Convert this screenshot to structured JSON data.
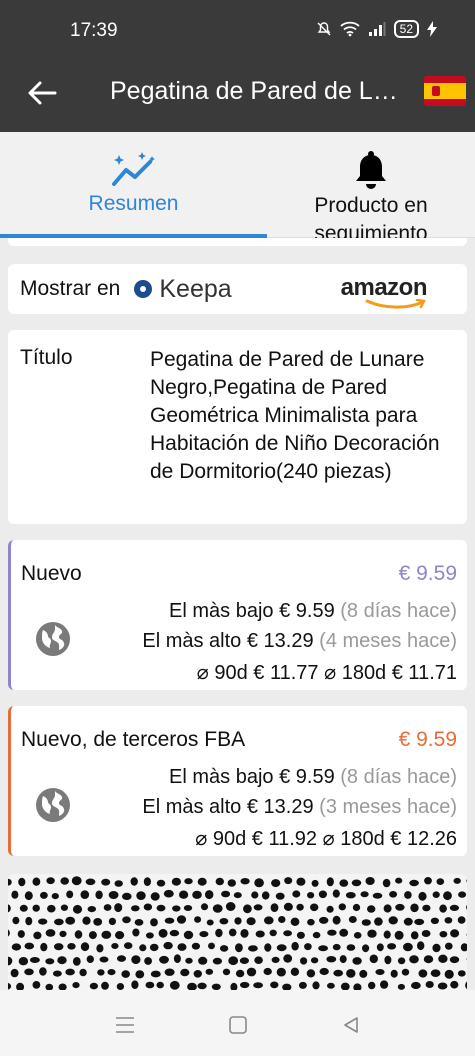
{
  "status_bar": {
    "time": "17:39",
    "battery": "52",
    "icons": [
      "mute-icon",
      "wifi-icon",
      "signal-icon",
      "battery-icon",
      "charging-icon"
    ]
  },
  "app_bar": {
    "title": "Pegatina de Pared de L…",
    "back_icon": "arrow-left-icon",
    "flag": "spain-flag"
  },
  "tabs": [
    {
      "label": "Resumen",
      "icon": "chart-sparkle-icon",
      "active": true
    },
    {
      "label": "Producto en seguimiento",
      "icon": "bell-icon",
      "active": false
    }
  ],
  "show_in": {
    "label": "Mostrar en",
    "keepa": "Keepa",
    "amazon": "amazon"
  },
  "title_section": {
    "label": "Título",
    "value": "Pegatina de Pared de Lunare Negro,Pegatina de Pared Geométrica Minimalista para Habitación de Niño Decoración de Dormitorio(240 piezas)"
  },
  "prices": [
    {
      "name": "Nuevo",
      "current": "€ 9.59",
      "accent": "#8e86cc",
      "lowest_label": "El màs bajo",
      "lowest_value": "€ 9.59",
      "lowest_when": "(8 días hace)",
      "highest_label": "El màs alto",
      "highest_value": "€ 13.29",
      "highest_when": "(4 meses hace)",
      "avg90_label": "⌀ 90d",
      "avg90_value": "€ 11.77",
      "avg180_label": "⌀ 180d",
      "avg180_value": "€ 11.71"
    },
    {
      "name": "Nuevo, de terceros FBA",
      "current": "€ 9.59",
      "accent": "#e56d38",
      "lowest_label": "El màs bajo",
      "lowest_value": "€ 9.59",
      "lowest_when": "(8 días hace)",
      "highest_label": "El màs alto",
      "highest_value": "€ 13.29",
      "highest_when": "(3 meses hace)",
      "avg90_label": "⌀ 90d",
      "avg90_value": "€ 11.92",
      "avg180_label": "⌀ 180d",
      "avg180_value": "€ 12.26"
    }
  ],
  "nav_bar": {
    "icons": [
      "menu-icon",
      "home-square-icon",
      "back-triangle-icon"
    ]
  }
}
